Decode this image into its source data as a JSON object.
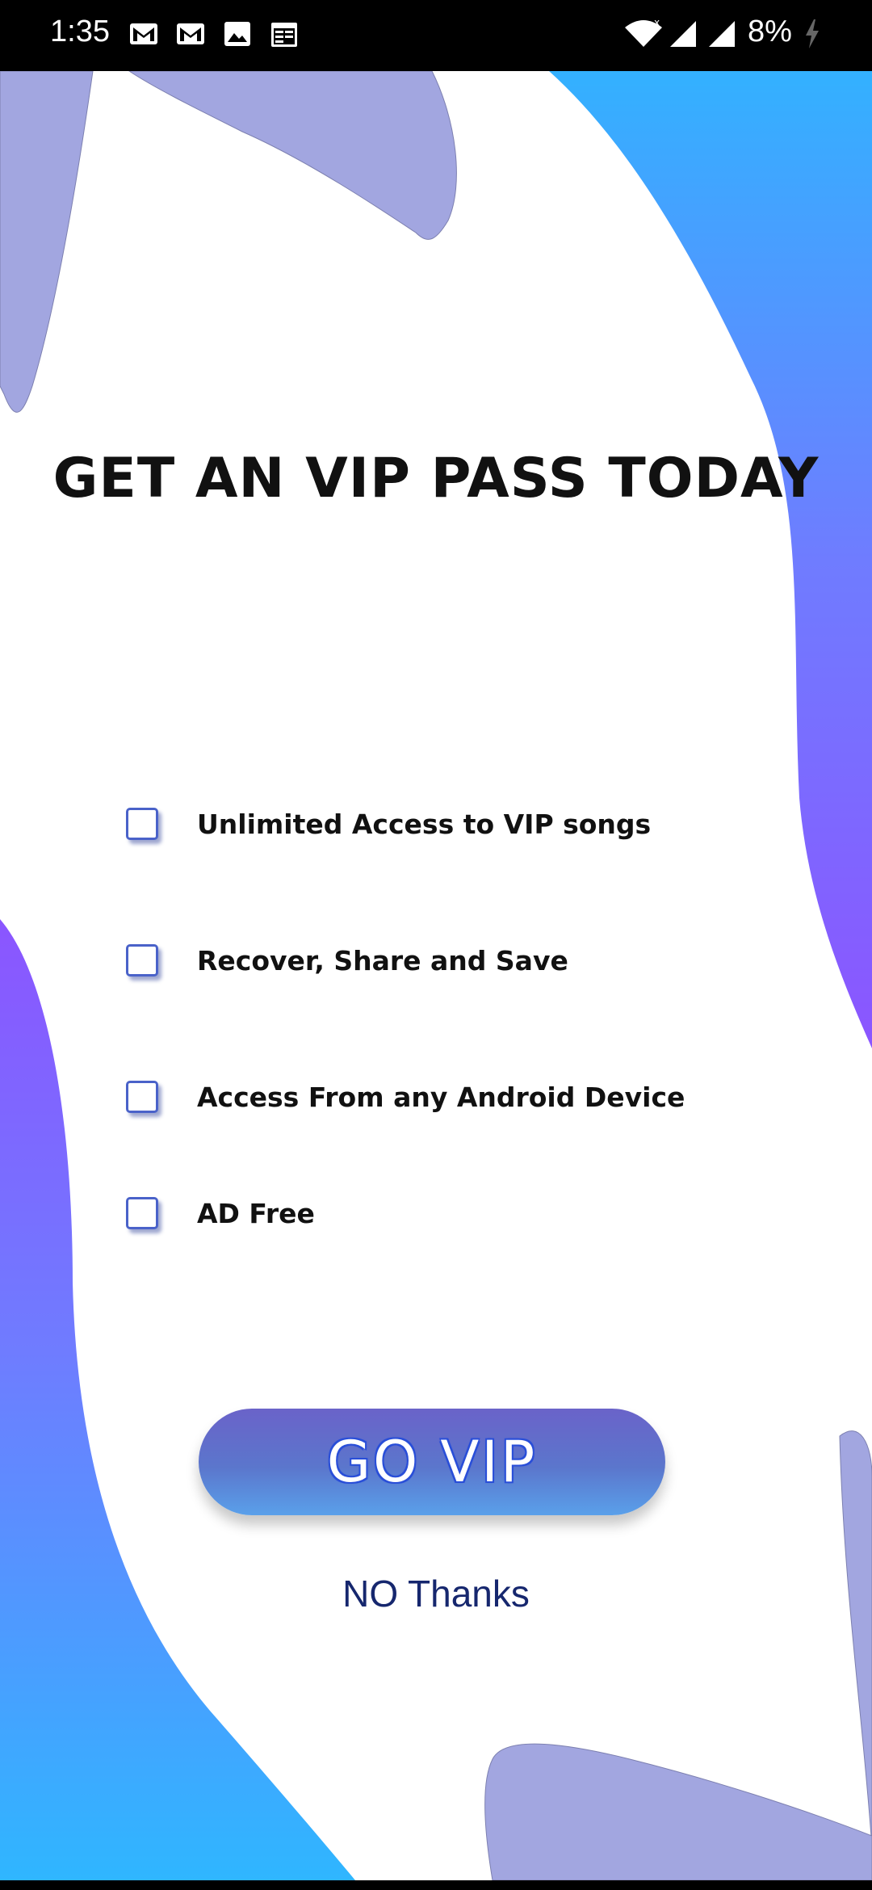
{
  "status_bar": {
    "time": "1:35",
    "battery_percent": "8%",
    "notification_icons": [
      "gmail-icon",
      "gmail-icon",
      "image-icon",
      "calendar-icon"
    ],
    "system_icons": [
      "wifi-icon",
      "cellular-signal-icon",
      "cellular-signal-icon",
      "battery-charging-icon"
    ]
  },
  "promo": {
    "title": "GET AN VIP PASS TODAY",
    "features": [
      {
        "label": "Unlimited Access to VIP songs",
        "checked": false
      },
      {
        "label": "Recover, Share and Save",
        "checked": false
      },
      {
        "label": "Access From any Android Device",
        "checked": false
      },
      {
        "label": "AD Free",
        "checked": false
      }
    ],
    "go_vip_label": "GO VIP",
    "no_thanks_label": "NO Thanks"
  },
  "colors": {
    "gradient_top": "#33b1ff",
    "gradient_mid": "#8b5cff",
    "blob_lavender": "#a2a6e0",
    "button_top": "#6a63c9",
    "button_bottom": "#5aa0ea",
    "no_thanks_text": "#16276e"
  }
}
